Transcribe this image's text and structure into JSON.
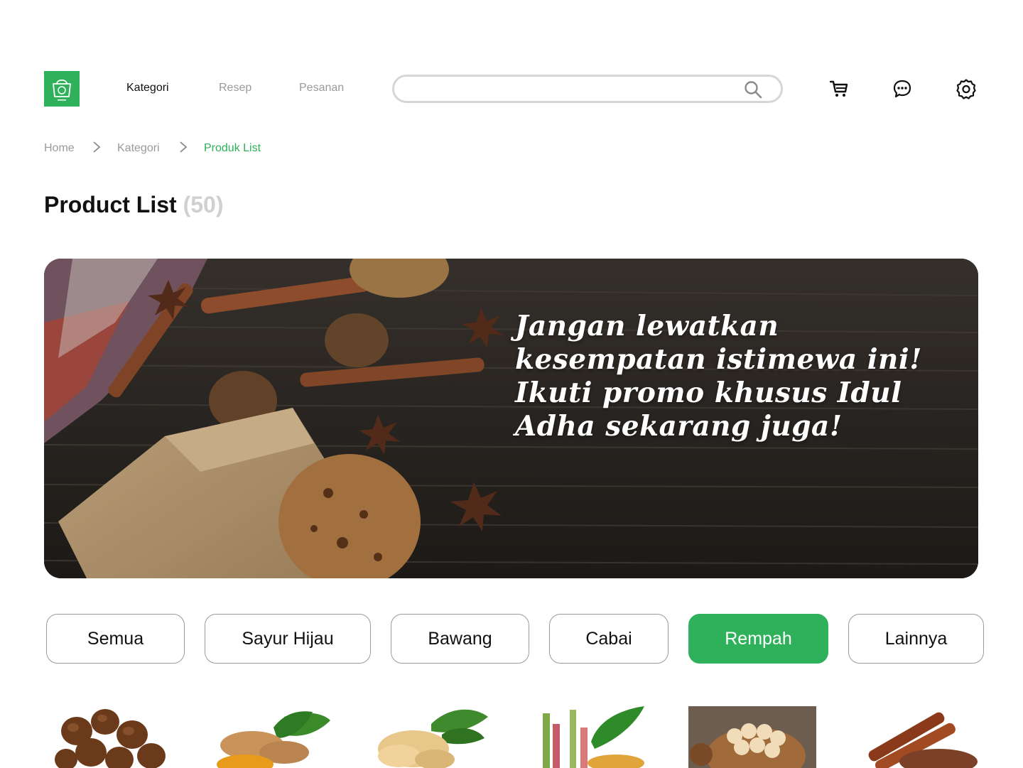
{
  "nav": {
    "items": [
      {
        "label": "Kategori",
        "active": true
      },
      {
        "label": "Resep",
        "active": false
      },
      {
        "label": "Pesanan",
        "active": false
      }
    ]
  },
  "search": {
    "value": "",
    "placeholder": ""
  },
  "header_icons": [
    "cart-icon",
    "chat-icon",
    "gear-icon"
  ],
  "breadcrumb": {
    "items": [
      "Home",
      "Kategori",
      "Produk List"
    ]
  },
  "page": {
    "title": "Product List",
    "count": "(50)"
  },
  "banner": {
    "text": "Jangan lewatkan kesempatan istimewa ini! Ikuti promo khusus Idul Adha sekarang juga!"
  },
  "categories": [
    {
      "label": "Semua",
      "active": false
    },
    {
      "label": "Sayur Hijau",
      "active": false
    },
    {
      "label": "Bawang",
      "active": false
    },
    {
      "label": "Cabai",
      "active": false
    },
    {
      "label": "Rempah",
      "active": true
    },
    {
      "label": "Lainnya",
      "active": false
    }
  ],
  "products": [
    "nutmeg",
    "turmeric",
    "ginger",
    "lemongrass",
    "hazelnut",
    "cinnamon"
  ],
  "colors": {
    "brand": "#2fb05a",
    "muted": "#9a9a9a",
    "border": "#d6d6d6"
  }
}
